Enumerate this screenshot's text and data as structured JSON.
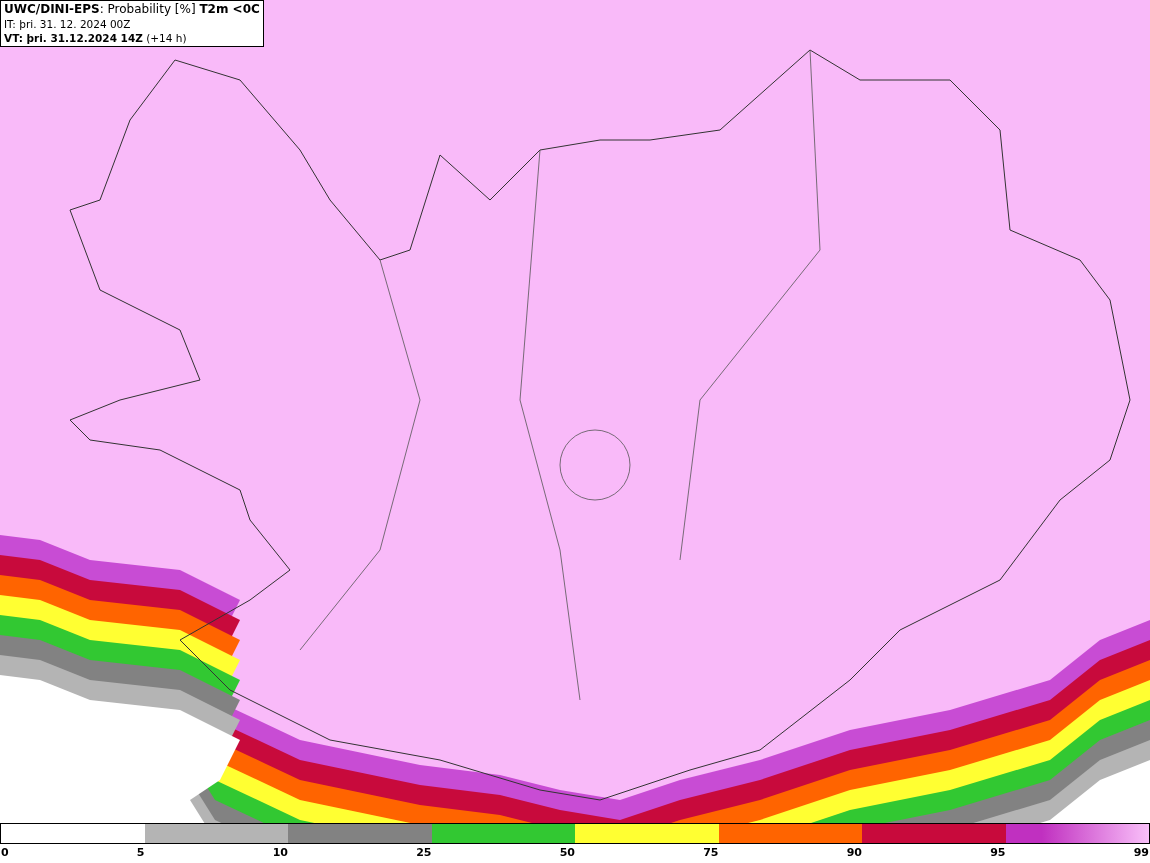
{
  "header": {
    "lines": [
      "**UWC/DINI-EPS**: Probability [%] **T2m <0C**",
      "IT: þri. 31. 12. 2024 00Z",
      "**VT: þri. 31.12.2024 14Z** (+14 h)"
    ]
  },
  "legend": {
    "segments": [
      {
        "kind": "solid",
        "color": "#b4b4b4"
      },
      {
        "kind": "solid",
        "color": "#828282"
      },
      {
        "kind": "solid",
        "color": "#32c832"
      },
      {
        "kind": "solid",
        "color": "#ffff32"
      },
      {
        "kind": "solid",
        "color": "#ff6400"
      },
      {
        "kind": "solid",
        "color": "#c80a3c"
      },
      {
        "kind": "gradient",
        "color": "#c030c0"
      }
    ],
    "ticks": [
      "0",
      "5",
      "10",
      "25",
      "50",
      "75",
      "90",
      "95",
      "99"
    ]
  }
}
